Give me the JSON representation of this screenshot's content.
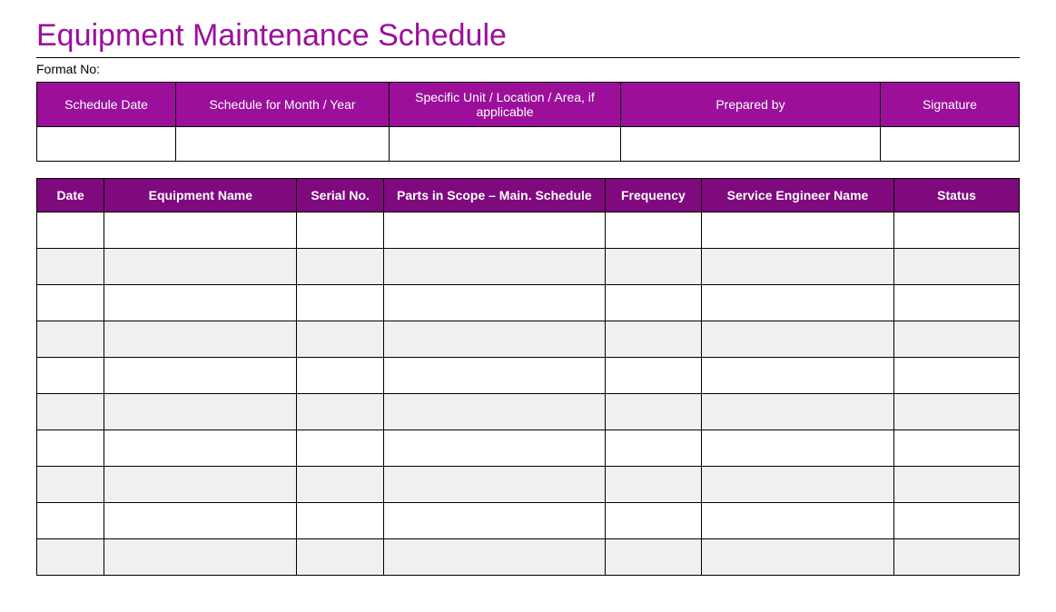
{
  "title": "Equipment Maintenance Schedule",
  "format_no_label": "Format No:",
  "info_headers": {
    "schedule_date": "Schedule Date",
    "schedule_for": "Schedule for Month / Year",
    "specific_unit": "Specific Unit / Location  / Area, if applicable",
    "prepared_by": "Prepared  by",
    "signature": "Signature"
  },
  "info_row": {
    "schedule_date": "",
    "schedule_for": "",
    "specific_unit": "",
    "prepared_by": "",
    "signature": ""
  },
  "main_headers": {
    "date": "Date",
    "equipment_name": "Equipment Name",
    "serial_no": "Serial No.",
    "parts_scope": "Parts in Scope – Main. Schedule",
    "frequency": "Frequency",
    "engineer": "Service Engineer Name",
    "status": "Status"
  },
  "main_rows": [
    {
      "date": "",
      "equipment_name": "",
      "serial_no": "",
      "parts_scope": "",
      "frequency": "",
      "engineer": "",
      "status": ""
    },
    {
      "date": "",
      "equipment_name": "",
      "serial_no": "",
      "parts_scope": "",
      "frequency": "",
      "engineer": "",
      "status": ""
    },
    {
      "date": "",
      "equipment_name": "",
      "serial_no": "",
      "parts_scope": "",
      "frequency": "",
      "engineer": "",
      "status": ""
    },
    {
      "date": "",
      "equipment_name": "",
      "serial_no": "",
      "parts_scope": "",
      "frequency": "",
      "engineer": "",
      "status": ""
    },
    {
      "date": "",
      "equipment_name": "",
      "serial_no": "",
      "parts_scope": "",
      "frequency": "",
      "engineer": "",
      "status": ""
    },
    {
      "date": "",
      "equipment_name": "",
      "serial_no": "",
      "parts_scope": "",
      "frequency": "",
      "engineer": "",
      "status": ""
    },
    {
      "date": "",
      "equipment_name": "",
      "serial_no": "",
      "parts_scope": "",
      "frequency": "",
      "engineer": "",
      "status": ""
    },
    {
      "date": "",
      "equipment_name": "",
      "serial_no": "",
      "parts_scope": "",
      "frequency": "",
      "engineer": "",
      "status": ""
    },
    {
      "date": "",
      "equipment_name": "",
      "serial_no": "",
      "parts_scope": "",
      "frequency": "",
      "engineer": "",
      "status": ""
    },
    {
      "date": "",
      "equipment_name": "",
      "serial_no": "",
      "parts_scope": "",
      "frequency": "",
      "engineer": "",
      "status": ""
    }
  ]
}
